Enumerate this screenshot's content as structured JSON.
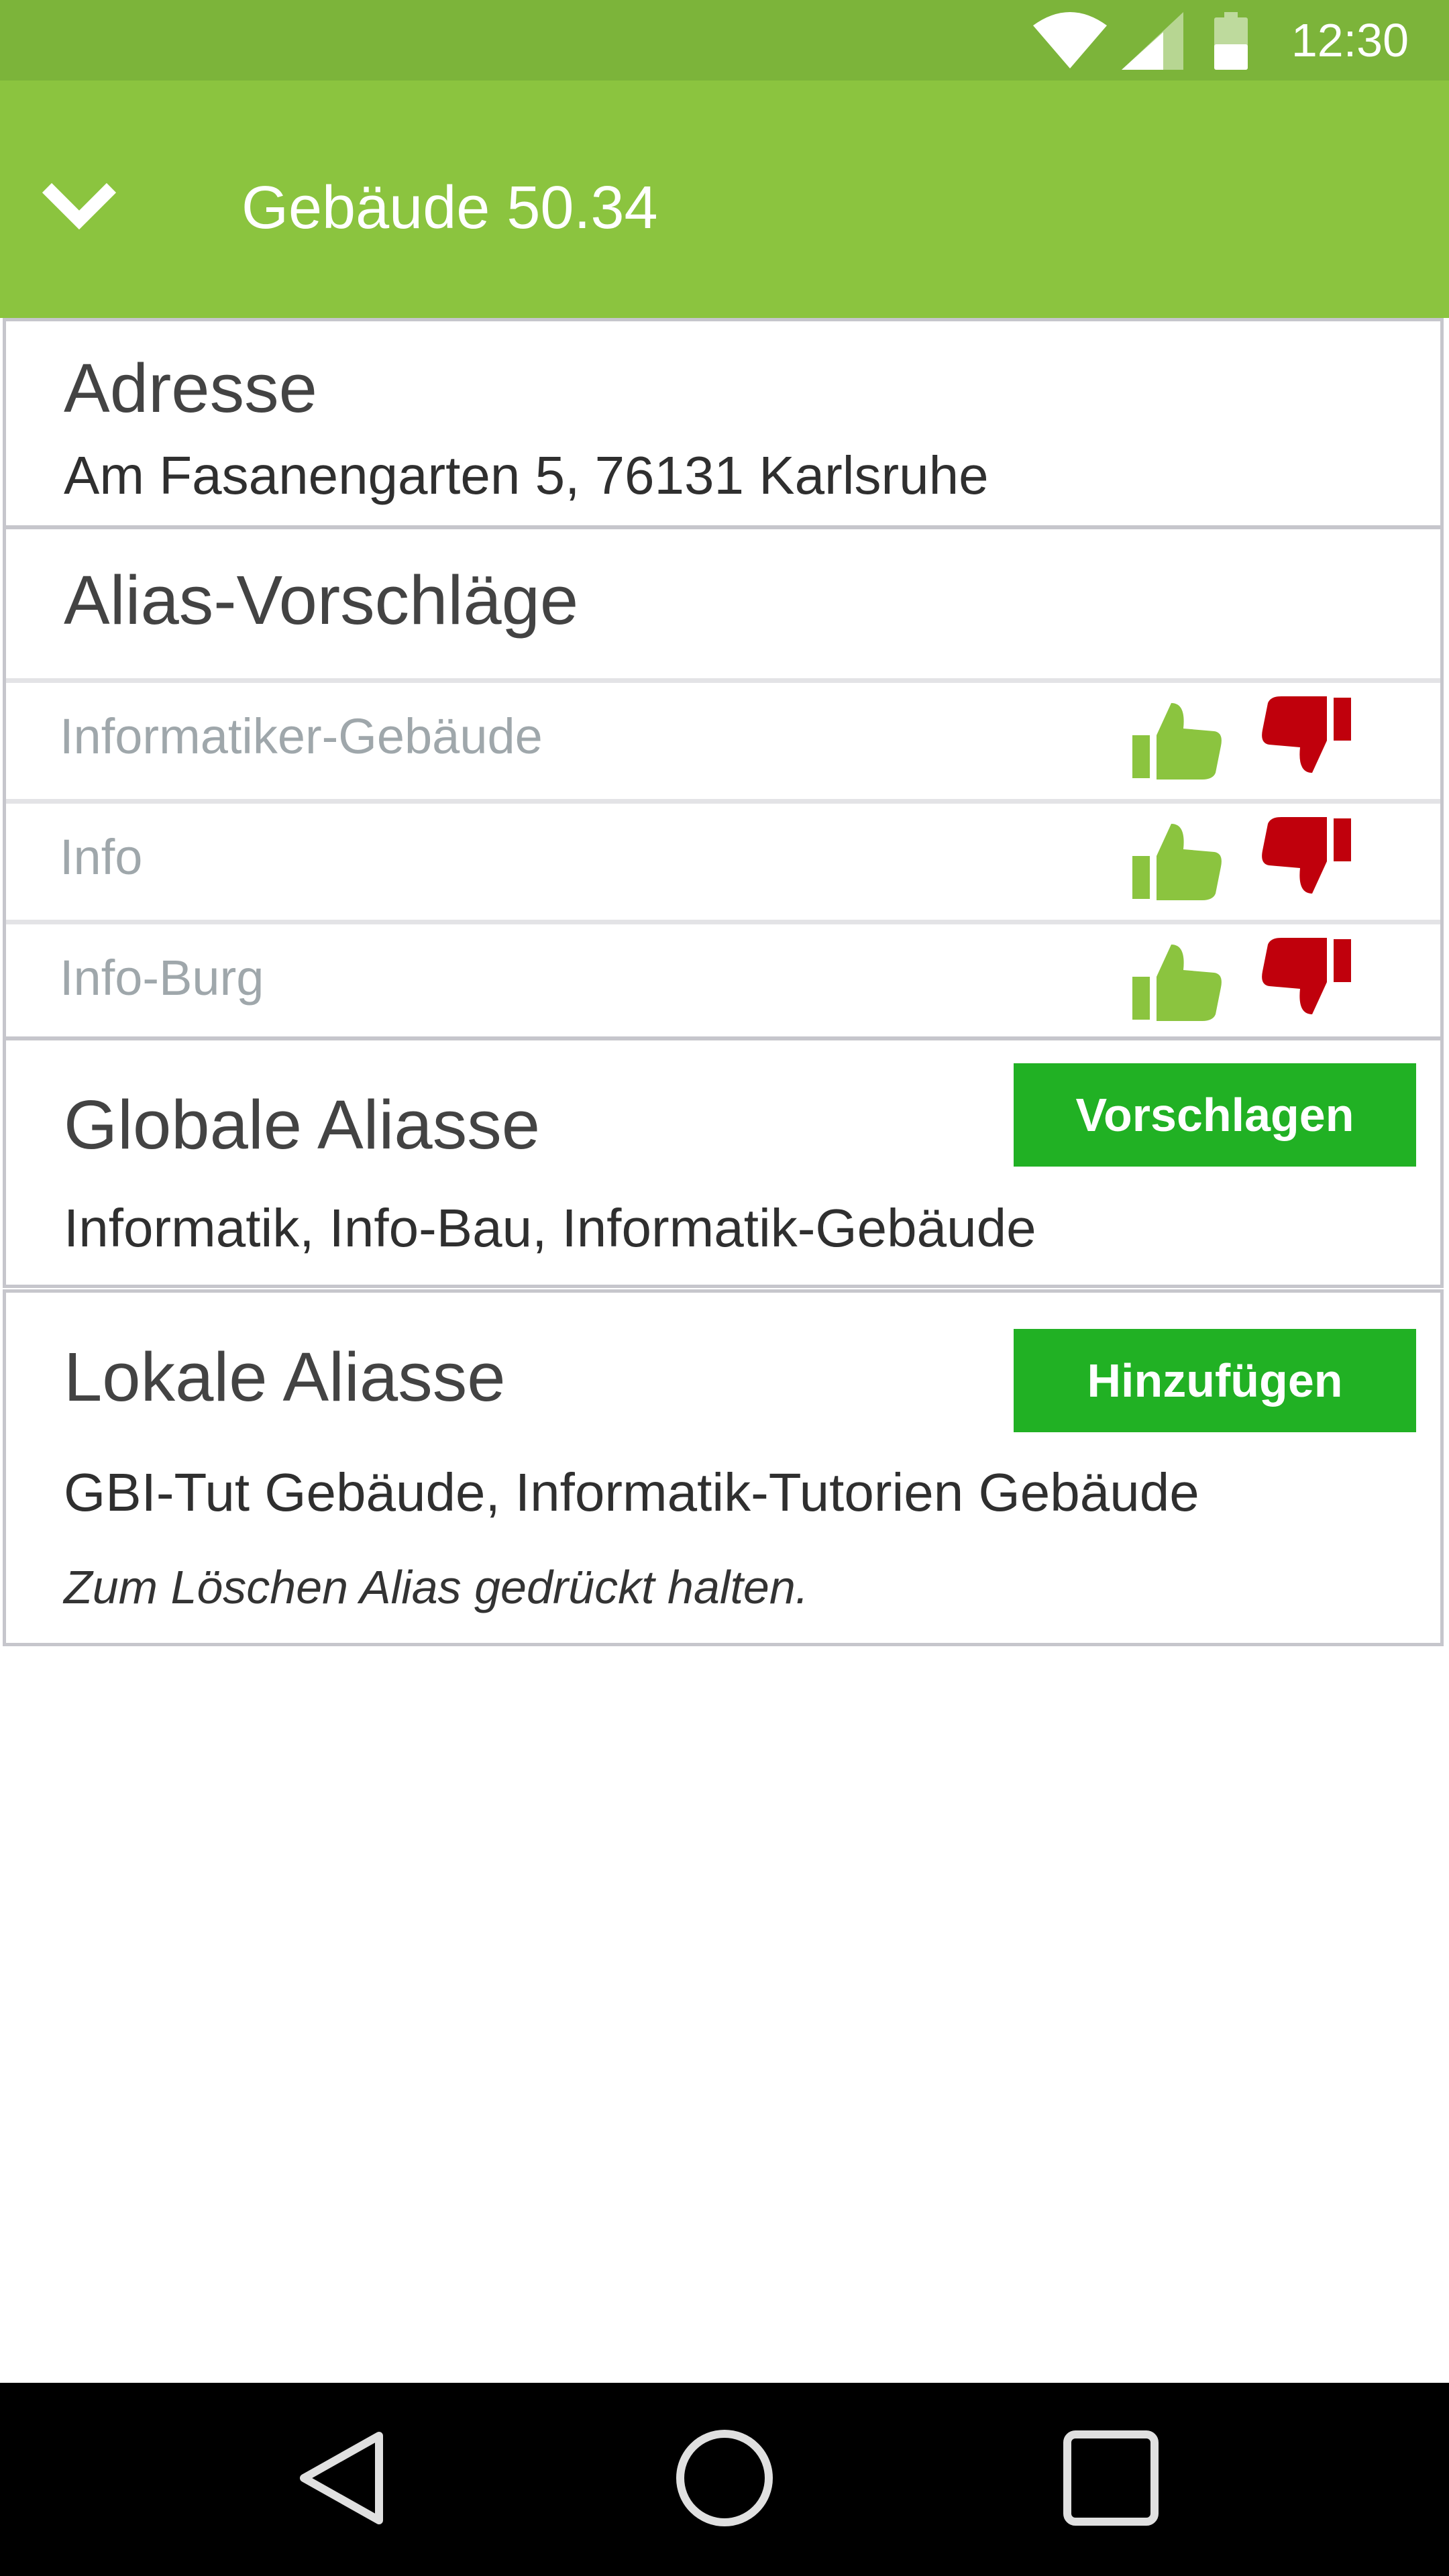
{
  "status_bar": {
    "time": "12:30",
    "icons": [
      "wifi-icon",
      "signal-icon",
      "battery-icon"
    ]
  },
  "app_bar": {
    "title": "Gebäude 50.34",
    "back_icon": "chevron-down-icon"
  },
  "address_card": {
    "title": "Adresse",
    "text": "Am Fasanengarten 5, 76131 Karlsruhe"
  },
  "alias_suggestions": {
    "title": "Alias-Vorschläge",
    "items": [
      {
        "label": "Informatiker-Gebäude"
      },
      {
        "label": "Info"
      },
      {
        "label": "Info-Burg"
      }
    ],
    "upvote_icon": "thumbs-up-icon",
    "downvote_icon": "thumbs-down-icon"
  },
  "global_aliases": {
    "title": "Globale Aliasse",
    "button": "Vorschlagen",
    "text": "Informatik, Info-Bau, Informatik-Gebäude"
  },
  "local_aliases": {
    "title": "Lokale Aliasse",
    "button": "Hinzufügen",
    "text": "GBI-Tut Gebäude, Informatik-Tutorien Gebäude",
    "hint": "Zum Löschen Alias gedrückt halten."
  },
  "nav_bar": {
    "icons": [
      "back-triangle-icon",
      "home-circle-icon",
      "recents-square-icon"
    ]
  },
  "colors": {
    "status_bar": "#7cb43a",
    "app_bar": "#8bc43f",
    "thumb_up": "#8bc43f",
    "thumb_down": "#c0000c",
    "button": "#21b124"
  }
}
